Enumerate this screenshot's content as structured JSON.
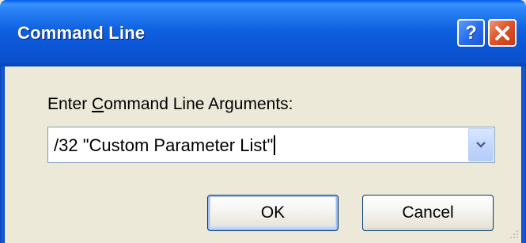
{
  "window": {
    "title": "Command Line",
    "help_label": "?",
    "close_label": "Close"
  },
  "prompt": {
    "text_before": "Enter ",
    "accelerator": "C",
    "text_after": "ommand Line Arguments:"
  },
  "combo": {
    "value": "/32 \"Custom Parameter List\""
  },
  "buttons": {
    "ok": "OK",
    "cancel": "Cancel"
  },
  "icons": {
    "help": "help-icon",
    "close": "close-icon",
    "dropdown": "chevron-down-icon",
    "grip": "resize-grip-icon"
  },
  "colors": {
    "titlebar": "#0a55d6",
    "close_button": "#e0552a",
    "dialog_bg": "#ece9d8",
    "default_button_highlight": "#a3bdf0"
  }
}
